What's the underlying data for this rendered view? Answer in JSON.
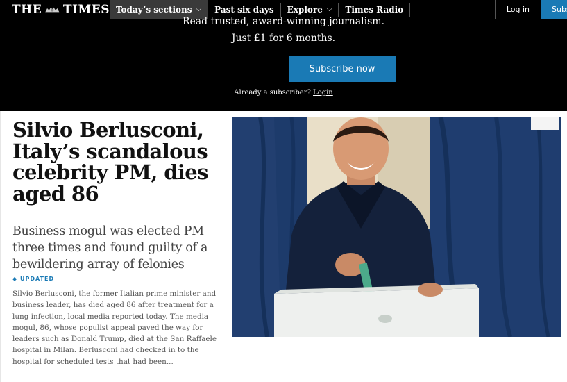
{
  "nav": {
    "logo_text": "THE TIMES",
    "items": [
      {
        "label": "Today’s sections",
        "has_dropdown": true,
        "active": true
      },
      {
        "label": "Past six days",
        "has_dropdown": false
      },
      {
        "label": "Explore",
        "has_dropdown": true
      },
      {
        "label": "Times Radio",
        "has_dropdown": false
      }
    ],
    "login_label": "Log in",
    "subscribe_label": "Subscribe"
  },
  "promo": {
    "line1": "Read trusted, award-winning journalism.",
    "line2": "Just £1 for 6 months.",
    "button_label": "Subscribe now",
    "already_text": "Already a subscriber?",
    "login_link": "Login"
  },
  "article": {
    "headline": "Silvio Berlusconi, Italy’s scandalous celebrity PM, dies aged 86",
    "standfirst": "Business mogul was elected PM three times and found guilty of a bewildering array of felonies",
    "badge": "UPDATED",
    "summary": "Silvio Berlusconi, the former Italian prime minister and business leader, has died aged 86 after treatment for a lung infection, local media reported today. The media mogul, 86, whose populist appeal paved the way for leaders such as Donald Trump, died at the San Raffaele hospital in Milan. Berlusconi had checked in to the hospital for scheduled tests that had been..."
  },
  "colors": {
    "brand_blue": "#1a7ab5",
    "nav_bg": "#000000"
  }
}
